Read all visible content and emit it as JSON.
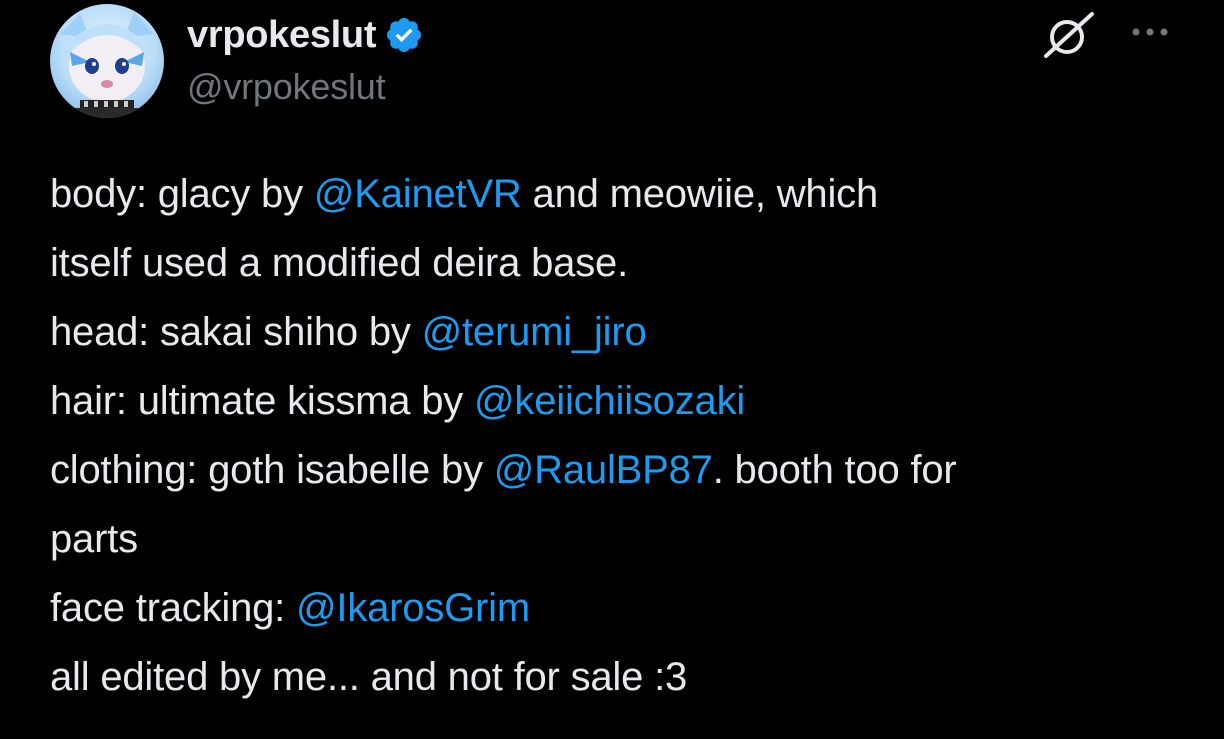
{
  "author": {
    "display_name": "vrpokeslut",
    "handle": "@vrpokeslut",
    "verified": true,
    "verified_color": "#1d9bf0"
  },
  "icons": {
    "grok": "grok-icon",
    "more": "more-icon"
  },
  "colors": {
    "background": "#000000",
    "text": "#e7e9ea",
    "secondary": "#71767b",
    "link": "#1d9bf0"
  },
  "body": {
    "l1_a": "body: glacy by ",
    "l1_m": "@KainetVR",
    "l1_b": " and meowiie, which",
    "l2": "itself used a modified deira base.",
    "l3_a": "head: sakai shiho by ",
    "l3_m": "@terumi_jiro",
    "l4_a": "hair: ultimate kissma by ",
    "l4_m": "@keiichiisozaki",
    "l5_a": "clothing: goth isabelle by ",
    "l5_m": "@RaulBP87",
    "l5_b": ". booth too for",
    "l6": "parts",
    "l7_a": "face tracking: ",
    "l7_m": "@IkarosGrim",
    "l8": "all edited by me... and not for sale :3"
  }
}
